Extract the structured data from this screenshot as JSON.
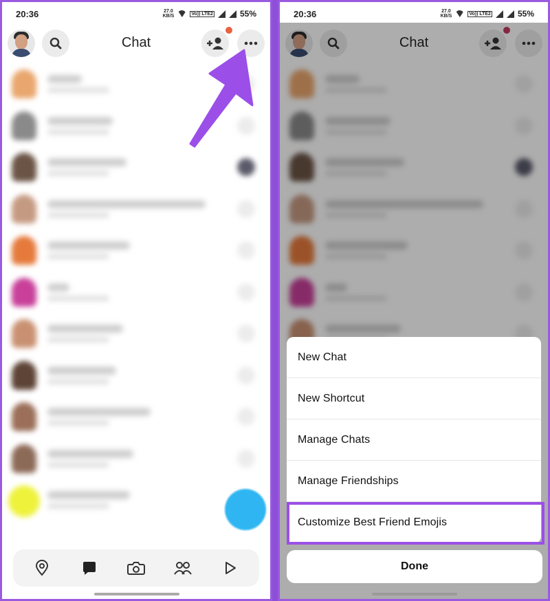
{
  "status": {
    "time": "20:36",
    "speed_value": "27.0",
    "speed_unit": "KB/S",
    "network": "Vo)) LTE2",
    "battery": "55%"
  },
  "header": {
    "title": "Chat"
  },
  "menu": {
    "items": [
      {
        "label": "New Chat"
      },
      {
        "label": "New Shortcut"
      },
      {
        "label": "Manage Chats"
      },
      {
        "label": "Manage Friendships"
      },
      {
        "label": "Customize Best Friend Emojis"
      }
    ],
    "done_label": "Done"
  },
  "colors": {
    "accent_purple": "#9c4fe6",
    "fab_blue": "#2fb6f2",
    "badge_red": "#e8623f"
  },
  "icons": {
    "header": [
      "search-icon",
      "add-friend-icon",
      "more-icon"
    ],
    "nav": [
      "map-pin-icon",
      "chat-bubble-icon",
      "camera-icon",
      "friends-icon",
      "play-icon"
    ]
  }
}
